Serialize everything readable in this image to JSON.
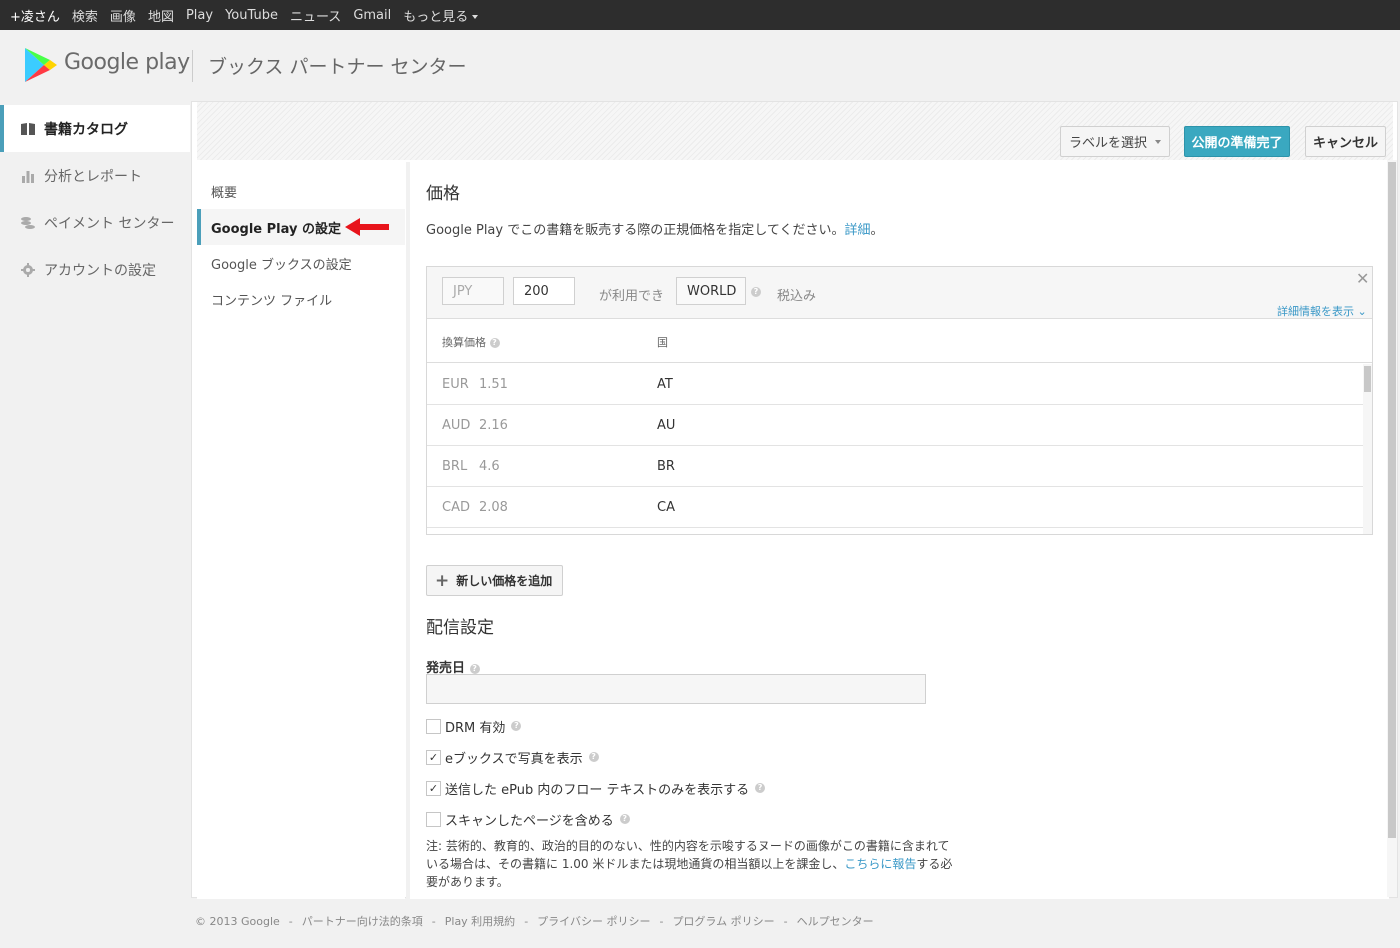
{
  "gbar": {
    "user": "+凌さん",
    "links": [
      "検索",
      "画像",
      "地図",
      "Play",
      "YouTube",
      "ニュース",
      "Gmail"
    ],
    "more": "もっと見る"
  },
  "header": {
    "brand": "Google play",
    "product": "ブックス パートナー センター"
  },
  "leftnav": {
    "items": [
      {
        "label": "書籍カタログ",
        "icon": "book-icon",
        "active": true
      },
      {
        "label": "分析とレポート",
        "icon": "bar-chart-icon"
      },
      {
        "label": "ペイメント センター",
        "icon": "coins-icon"
      },
      {
        "label": "アカウントの設定",
        "icon": "gear-icon"
      }
    ]
  },
  "toolbar": {
    "label_select": "ラベルを選択",
    "publish": "公開の準備完了",
    "cancel": "キャンセル"
  },
  "subnav": {
    "items": [
      "概要",
      "Google Play の設定",
      "Google ブックスの設定",
      "コンテンツ ファイル"
    ],
    "active_index": 1
  },
  "price": {
    "title": "価格",
    "description": "Google Play でこの書籍を販売する際の正規価格を指定してください。",
    "details_link": "詳細",
    "period": "。",
    "currency": "JPY",
    "amount": "200",
    "available_label": "が利用でき",
    "region": "WORLD",
    "tax_label": "税込み",
    "show_details": "詳細情報を表示",
    "col_converted": "換算価格",
    "col_country": "国",
    "rows": [
      {
        "currency": "EUR",
        "value": "1.51",
        "country": "AT"
      },
      {
        "currency": "AUD",
        "value": "2.16",
        "country": "AU"
      },
      {
        "currency": "BRL",
        "value": "4.6",
        "country": "BR"
      },
      {
        "currency": "CAD",
        "value": "2.08",
        "country": "CA"
      }
    ],
    "add_button": "新しい価格を追加"
  },
  "distribution": {
    "title": "配信設定",
    "release_date_label": "発売日",
    "release_date_value": "",
    "checkboxes": [
      {
        "label": "DRM 有効",
        "checked": false
      },
      {
        "label": "eブックスで写真を表示",
        "checked": true
      },
      {
        "label": "送信した ePub 内のフロー テキストのみを表示する",
        "checked": true
      },
      {
        "label": "スキャンしたページを含める",
        "checked": false
      }
    ],
    "note_prefix": "注: 芸術的、教育的、政治的目的のない、性的内容を示唆するヌードの画像がこの書籍に含まれている場合は、その書籍に 1.00 米ドルまたは現地通貨の相当額以上を課金し、",
    "note_link": "こちらに報告",
    "note_suffix": "する必要があります。"
  },
  "footer": {
    "copyright": "© 2013 Google",
    "links": [
      "パートナー向け法的条項",
      "Play 利用規約",
      "プライバシー ポリシー",
      "プログラム ポリシー",
      "ヘルプセンター"
    ]
  },
  "colors": {
    "accent": "#4b9fba",
    "publish_button": "#3aa8c0",
    "link": "#3a98c7",
    "annotation_arrow": "#e8141b"
  }
}
